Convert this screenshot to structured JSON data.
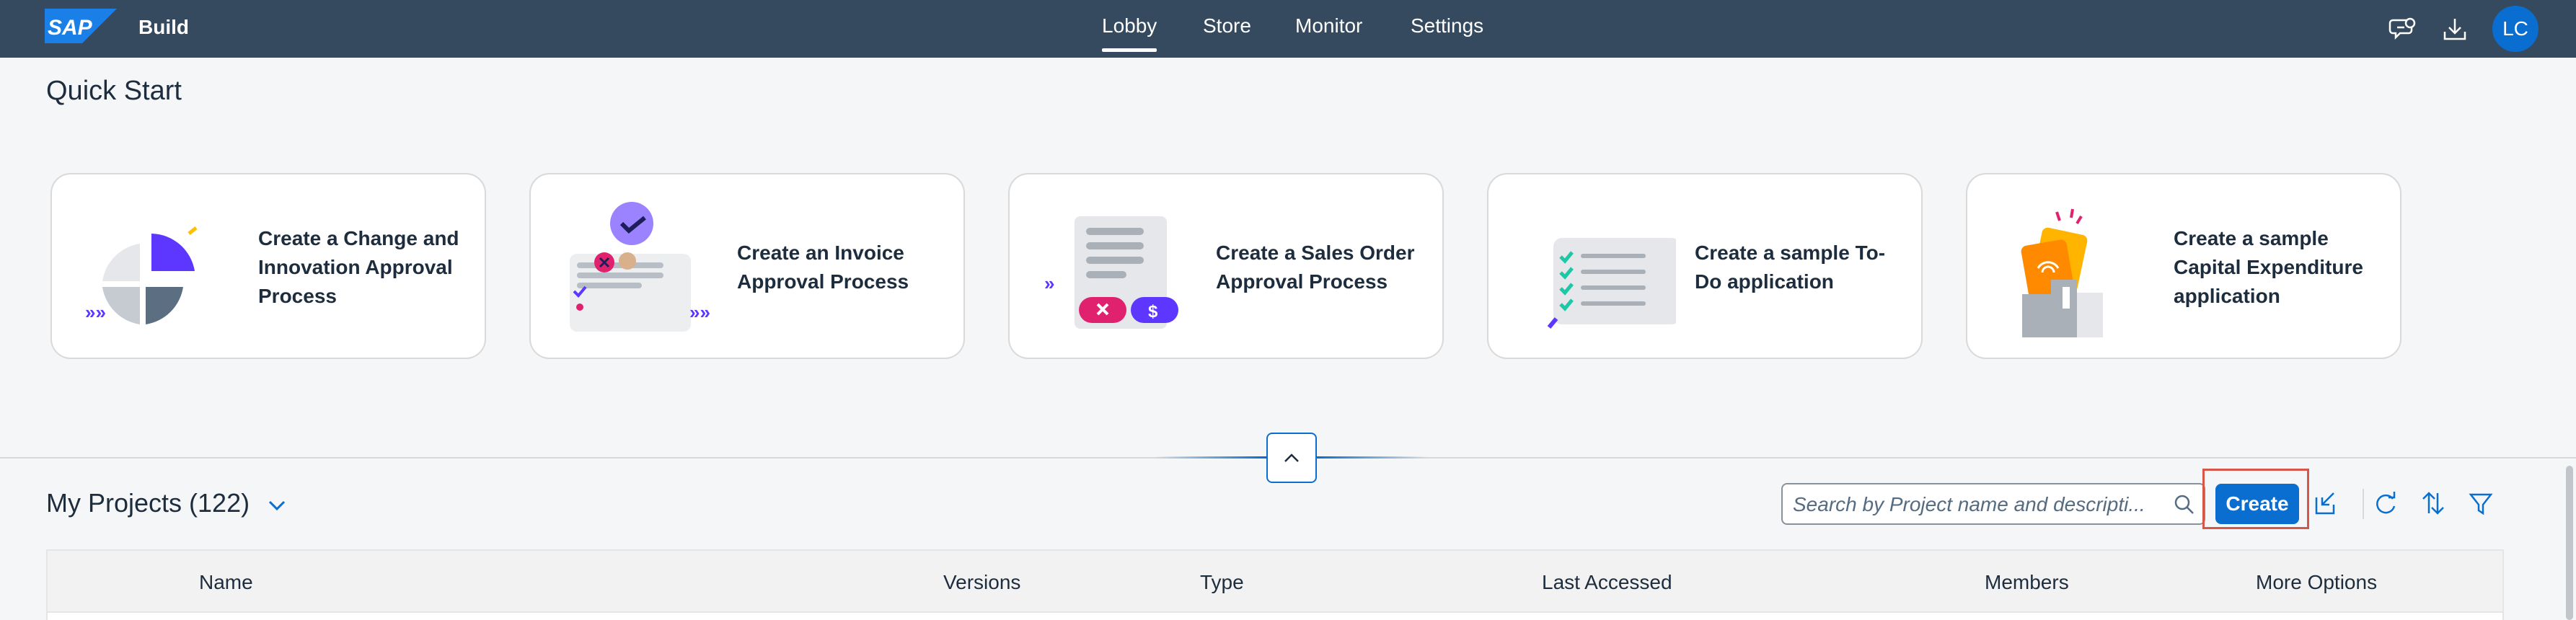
{
  "shell": {
    "logo_text": "SAP",
    "app_name": "Build",
    "tabs": [
      {
        "label": "Lobby",
        "active": true
      },
      {
        "label": "Store",
        "active": false
      },
      {
        "label": "Monitor",
        "active": false
      },
      {
        "label": "Settings",
        "active": false
      }
    ],
    "icons": [
      "feedback-icon",
      "download-icon"
    ],
    "avatar_initials": "LC"
  },
  "quick_start": {
    "title": "Quick Start",
    "cards": [
      {
        "label": "Create a Change and Innovation Approval Process",
        "illustration": "pie-chart"
      },
      {
        "label": "Create an Invoice Approval Process",
        "illustration": "invoice"
      },
      {
        "label": "Create a Sales Order Approval Process",
        "illustration": "sales-order"
      },
      {
        "label": "Create a sample To-Do application",
        "illustration": "todo-list"
      },
      {
        "label": "Create a sample Capital Expenditure application",
        "illustration": "capex"
      }
    ]
  },
  "projects": {
    "title": "My Projects (122)",
    "search_placeholder": "Search by Project name and descripti...",
    "create_label": "Create",
    "toolbar_icons": [
      "import-icon",
      "refresh-icon",
      "sort-icon",
      "filter-icon"
    ],
    "columns": [
      "Name",
      "Versions",
      "Type",
      "Last Accessed",
      "Members",
      "More Options"
    ]
  },
  "colors": {
    "shell_bg": "#354a5f",
    "accent": "#0a6ed1",
    "highlight": "#d6564a",
    "purple": "#5d36ff",
    "pink": "#e0226e",
    "teal": "#1bc9a6",
    "orange": "#ff8a00"
  }
}
